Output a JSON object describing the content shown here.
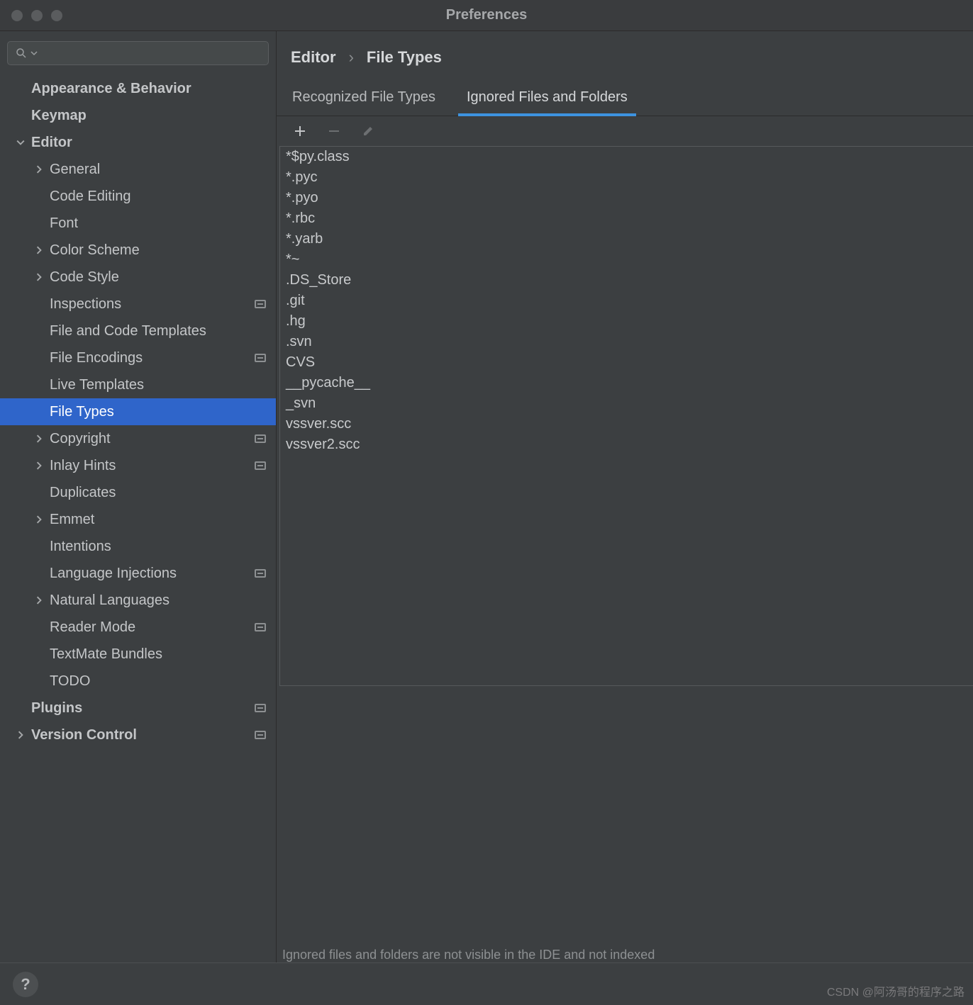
{
  "window_title": "Preferences",
  "breadcrumb": {
    "root": "Editor",
    "leaf": "File Types",
    "sep": "›"
  },
  "tabs": [
    {
      "label": "Recognized File Types",
      "active": false
    },
    {
      "label": "Ignored Files and Folders",
      "active": true
    }
  ],
  "ignore_list": [
    "*$py.class",
    "*.pyc",
    "*.pyo",
    "*.rbc",
    "*.yarb",
    "*~",
    ".DS_Store",
    ".git",
    ".hg",
    ".svn",
    "CVS",
    "__pycache__",
    "_svn",
    "vssver.scc",
    "vssver2.scc"
  ],
  "hint": "Ignored files and folders are not visible in the IDE and not indexed",
  "sidebar": [
    {
      "label": "Appearance & Behavior",
      "level": "top",
      "chev": "",
      "marker": false
    },
    {
      "label": "Keymap",
      "level": "top",
      "chev": "",
      "marker": false
    },
    {
      "label": "Editor",
      "level": "top",
      "chev": "down",
      "marker": false
    },
    {
      "label": "General",
      "level": "child",
      "chev": "right",
      "marker": false
    },
    {
      "label": "Code Editing",
      "level": "child",
      "chev": "",
      "marker": false
    },
    {
      "label": "Font",
      "level": "child",
      "chev": "",
      "marker": false
    },
    {
      "label": "Color Scheme",
      "level": "child",
      "chev": "right",
      "marker": false
    },
    {
      "label": "Code Style",
      "level": "child",
      "chev": "right",
      "marker": false
    },
    {
      "label": "Inspections",
      "level": "child",
      "chev": "",
      "marker": true
    },
    {
      "label": "File and Code Templates",
      "level": "child",
      "chev": "",
      "marker": false
    },
    {
      "label": "File Encodings",
      "level": "child",
      "chev": "",
      "marker": true
    },
    {
      "label": "Live Templates",
      "level": "child",
      "chev": "",
      "marker": false
    },
    {
      "label": "File Types",
      "level": "child",
      "chev": "",
      "marker": false,
      "selected": true
    },
    {
      "label": "Copyright",
      "level": "child",
      "chev": "right",
      "marker": true
    },
    {
      "label": "Inlay Hints",
      "level": "child",
      "chev": "right",
      "marker": true
    },
    {
      "label": "Duplicates",
      "level": "child",
      "chev": "",
      "marker": false
    },
    {
      "label": "Emmet",
      "level": "child",
      "chev": "right",
      "marker": false
    },
    {
      "label": "Intentions",
      "level": "child",
      "chev": "",
      "marker": false
    },
    {
      "label": "Language Injections",
      "level": "child",
      "chev": "",
      "marker": true
    },
    {
      "label": "Natural Languages",
      "level": "child",
      "chev": "right",
      "marker": false
    },
    {
      "label": "Reader Mode",
      "level": "child",
      "chev": "",
      "marker": true
    },
    {
      "label": "TextMate Bundles",
      "level": "child",
      "chev": "",
      "marker": false
    },
    {
      "label": "TODO",
      "level": "child",
      "chev": "",
      "marker": false
    },
    {
      "label": "Plugins",
      "level": "top",
      "chev": "",
      "marker": true
    },
    {
      "label": "Version Control",
      "level": "top",
      "chev": "right",
      "marker": true
    }
  ],
  "help_label": "?",
  "watermark": "CSDN @阿汤哥的程序之路"
}
